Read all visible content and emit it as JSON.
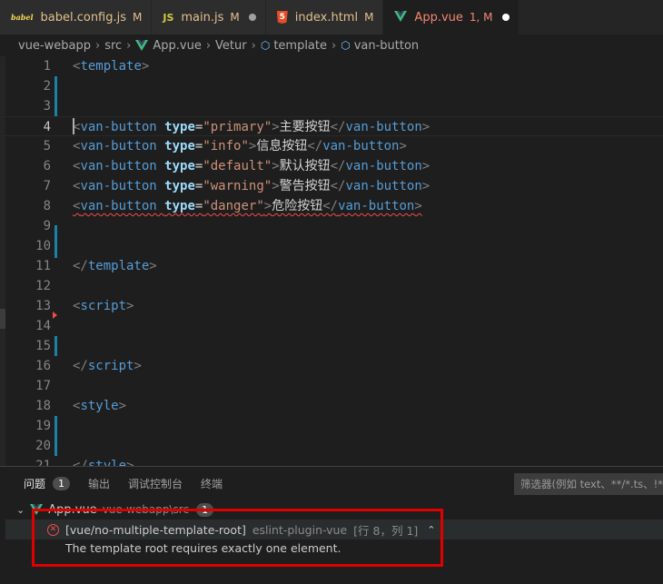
{
  "tabs": [
    {
      "name": "babel.config.js",
      "status": "M",
      "icon": "babel-icon",
      "dot": false,
      "active": false
    },
    {
      "name": "main.js",
      "status": "M",
      "icon": "js-icon",
      "dot": true,
      "active": false
    },
    {
      "name": "index.html",
      "status": "M",
      "icon": "html-icon",
      "dot": false,
      "active": false
    },
    {
      "name": "App.vue",
      "status": "1, M",
      "icon": "vue-icon",
      "dot": true,
      "active": true
    }
  ],
  "tab_icon_text": {
    "babel": "babel",
    "js": "JS",
    "html": "5"
  },
  "breadcrumb": [
    "vue-webapp",
    "src",
    "App.vue",
    "Vetur",
    "template",
    "van-button"
  ],
  "editor": {
    "lines": [
      {
        "n": "1",
        "parts": [
          [
            "tagc",
            "<"
          ],
          [
            "tagn",
            "template"
          ],
          [
            "tagc",
            ">"
          ]
        ]
      },
      {
        "n": "2",
        "parts": []
      },
      {
        "n": "3",
        "parts": []
      },
      {
        "n": "4",
        "parts": [
          [
            "tagc",
            "<"
          ],
          [
            "tagn",
            "van-button"
          ],
          [
            "txt",
            " "
          ],
          [
            "attr",
            "type"
          ],
          [
            "eq",
            "="
          ],
          [
            "str",
            "\"primary\""
          ],
          [
            "tagc",
            ">"
          ],
          [
            "txt",
            "主要按钮"
          ],
          [
            "tagc",
            "</"
          ],
          [
            "tagn",
            "van-button"
          ],
          [
            "tagc",
            ">"
          ]
        ]
      },
      {
        "n": "5",
        "parts": [
          [
            "tagc",
            "<"
          ],
          [
            "tagn",
            "van-button"
          ],
          [
            "txt",
            " "
          ],
          [
            "attr",
            "type"
          ],
          [
            "eq",
            "="
          ],
          [
            "str",
            "\"info\""
          ],
          [
            "tagc",
            ">"
          ],
          [
            "txt",
            "信息按钮"
          ],
          [
            "tagc",
            "</"
          ],
          [
            "tagn",
            "van-button"
          ],
          [
            "tagc",
            ">"
          ]
        ]
      },
      {
        "n": "6",
        "parts": [
          [
            "tagc",
            "<"
          ],
          [
            "tagn",
            "van-button"
          ],
          [
            "txt",
            " "
          ],
          [
            "attr",
            "type"
          ],
          [
            "eq",
            "="
          ],
          [
            "str",
            "\"default\""
          ],
          [
            "tagc",
            ">"
          ],
          [
            "txt",
            "默认按钮"
          ],
          [
            "tagc",
            "</"
          ],
          [
            "tagn",
            "van-button"
          ],
          [
            "tagc",
            ">"
          ]
        ]
      },
      {
        "n": "7",
        "parts": [
          [
            "tagc",
            "<"
          ],
          [
            "tagn",
            "van-button"
          ],
          [
            "txt",
            " "
          ],
          [
            "attr",
            "type"
          ],
          [
            "eq",
            "="
          ],
          [
            "str",
            "\"warning\""
          ],
          [
            "tagc",
            ">"
          ],
          [
            "txt",
            "警告按钮"
          ],
          [
            "tagc",
            "</"
          ],
          [
            "tagn",
            "van-button"
          ],
          [
            "tagc",
            ">"
          ]
        ]
      },
      {
        "n": "8",
        "parts": [
          [
            "tagc",
            "<"
          ],
          [
            "tagn",
            "van-button"
          ],
          [
            "txt",
            " "
          ],
          [
            "attr",
            "type"
          ],
          [
            "eq",
            "="
          ],
          [
            "str",
            "\"danger\""
          ],
          [
            "tagc",
            ">"
          ],
          [
            "txt",
            "危险按钮"
          ],
          [
            "tagc",
            "</"
          ],
          [
            "tagn",
            "van-button"
          ],
          [
            "tagc",
            ">"
          ]
        ]
      },
      {
        "n": "9",
        "parts": []
      },
      {
        "n": "10",
        "parts": []
      },
      {
        "n": "11",
        "parts": [
          [
            "tagc",
            "</"
          ],
          [
            "tagn",
            "template"
          ],
          [
            "tagc",
            ">"
          ]
        ]
      },
      {
        "n": "12",
        "parts": []
      },
      {
        "n": "13",
        "parts": [
          [
            "tagc",
            "<"
          ],
          [
            "tagn",
            "script"
          ],
          [
            "tagc",
            ">"
          ]
        ]
      },
      {
        "n": "14",
        "parts": []
      },
      {
        "n": "15",
        "parts": []
      },
      {
        "n": "16",
        "parts": [
          [
            "tagc",
            "</"
          ],
          [
            "tagn",
            "script"
          ],
          [
            "tagc",
            ">"
          ]
        ]
      },
      {
        "n": "17",
        "parts": []
      },
      {
        "n": "18",
        "parts": [
          [
            "tagc",
            "<"
          ],
          [
            "tagn",
            "style"
          ],
          [
            "tagc",
            ">"
          ]
        ]
      },
      {
        "n": "19",
        "parts": []
      },
      {
        "n": "20",
        "parts": []
      },
      {
        "n": "21",
        "parts": [
          [
            "tagc",
            "</"
          ],
          [
            "tagn",
            "style"
          ],
          [
            "tagc",
            ">"
          ]
        ]
      }
    ]
  },
  "panel": {
    "tabs": [
      {
        "label": "问题",
        "badge": "1",
        "active": true
      },
      {
        "label": "输出",
        "badge": "",
        "active": false
      },
      {
        "label": "调试控制台",
        "badge": "",
        "active": false
      },
      {
        "label": "终端",
        "badge": "",
        "active": false
      }
    ],
    "filter_placeholder": "筛选器(例如 text、**/*.ts、!**/",
    "file_group": {
      "name": "App.vue",
      "path": "vue-webapp\\src",
      "count": "1"
    },
    "problem": {
      "message": "[vue/no-multiple-template-root]",
      "source": "eslint-plugin-vue",
      "position": "[行 8，列 1]",
      "description": "The template root requires exactly one element."
    }
  },
  "colors": {
    "accent_error": "#f14c4c",
    "vue_green": "#42b883",
    "highlight_box": "#e00000"
  }
}
